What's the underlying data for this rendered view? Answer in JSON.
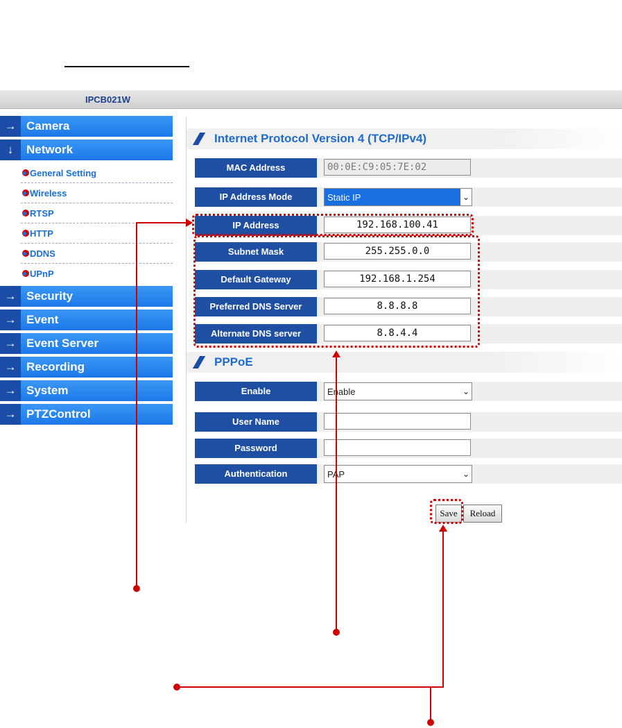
{
  "header": {
    "model": "IPCB021W"
  },
  "sidebar": {
    "menu": [
      {
        "label": "Camera",
        "arrow": "→"
      },
      {
        "label": "Network",
        "arrow": "↓"
      },
      {
        "label": "Security",
        "arrow": "→"
      },
      {
        "label": "Event",
        "arrow": "→"
      },
      {
        "label": "Event Server",
        "arrow": "→"
      },
      {
        "label": "Recording",
        "arrow": "→"
      },
      {
        "label": "System",
        "arrow": "→"
      },
      {
        "label": "PTZControl",
        "arrow": "→"
      }
    ],
    "network_sub": [
      "General Setting",
      "Wireless",
      "RTSP",
      "HTTP",
      "DDNS",
      "UPnP"
    ]
  },
  "ipv4": {
    "title": "Internet Protocol Version 4 (TCP/IPv4)",
    "mac_label": "MAC Address",
    "mac_value": "00:0E:C9:05:7E:02",
    "mode_label": "IP Address Mode",
    "mode_value": "Static IP",
    "ip_label": "IP Address",
    "ip_value": "192.168.100.41",
    "subnet_label": "Subnet Mask",
    "subnet_value": "255.255.0.0",
    "gateway_label": "Default Gateway",
    "gateway_value": "192.168.1.254",
    "dns1_label": "Preferred DNS Server",
    "dns1_value": "8.8.8.8",
    "dns2_label": "Alternate DNS server",
    "dns2_value": "8.8.4.4"
  },
  "pppoe": {
    "title": "PPPoE",
    "enable_label": "Enable",
    "enable_value": "Enable",
    "user_label": "User Name",
    "user_value": "",
    "pass_label": "Password",
    "pass_value": "",
    "auth_label": "Authentication",
    "auth_value": "PAP"
  },
  "buttons": {
    "save": "Save",
    "reload": "Reload"
  },
  "colors": {
    "accent": "#1f4fa3",
    "menu": "#2a86ef",
    "annotation": "#d10000"
  },
  "icons": {
    "menu_arrow": "arrow-right-icon",
    "select": "chevron-down-icon"
  }
}
